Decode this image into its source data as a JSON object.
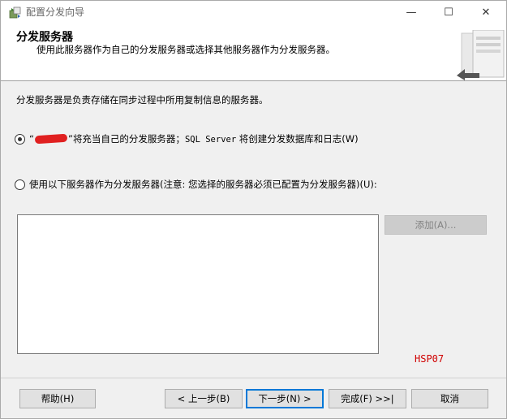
{
  "window": {
    "title": "配置分发向导",
    "min_glyph": "—",
    "max_glyph": "☐",
    "close_glyph": "✕"
  },
  "banner": {
    "title": "分发服务器",
    "subtitle": "使用此服务器作为自己的分发服务器或选择其他服务器作为分发服务器。"
  },
  "body": {
    "description": "分发服务器是负责存储在同步过程中所用复制信息的服务器。",
    "option_self": {
      "quote_open": "“",
      "quote_close": "”",
      "text_a": "将充当自己的分发服务器；",
      "text_mono": "SQL Server",
      "text_b": " 将创建分发数据库和日志(W)",
      "checked": true
    },
    "option_other": {
      "text": "使用以下服务器作为分发服务器(注意: 您选择的服务器必须已配置为分发服务器)(U):",
      "checked": false
    },
    "add_button": "添加(A)...",
    "annotation": "HSP07"
  },
  "footer": {
    "help": "帮助(H)",
    "prev": "< 上一步(B)",
    "next": "下一步(N) >",
    "finish": "完成(F) >>|",
    "cancel": "取消"
  },
  "colors": {
    "accent": "#0078d7",
    "annotation": "#d00000",
    "redaction": "#e02020"
  }
}
